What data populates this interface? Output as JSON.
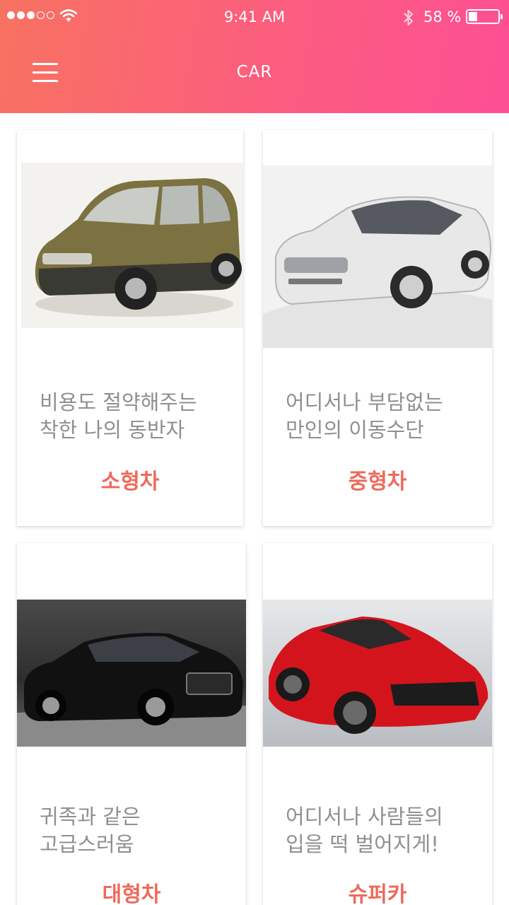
{
  "status_bar": {
    "time": "9:41 AM",
    "battery_percent": "58 %",
    "battery_level": 0.3
  },
  "header": {
    "title": "CAR",
    "gradient_start": "#f87261",
    "gradient_end": "#fd4f94"
  },
  "cards": [
    {
      "desc_line1": "비용도 절약해주는",
      "desc_line2": "착한 나의 동반자",
      "category": "소형차",
      "image_alt": "olive compact hatchback"
    },
    {
      "desc_line1": "어디서나 부담없는",
      "desc_line2": "만인의 이동수단",
      "category": "중형차",
      "image_alt": "silver midsize sedan"
    },
    {
      "desc_line1": "귀족과 같은",
      "desc_line2": "고급스러움",
      "category": "대형차",
      "image_alt": "black luxury sedan"
    },
    {
      "desc_line1": "어디서나 사람들의",
      "desc_line2": "입을 떡 벌어지게!",
      "category": "슈퍼카",
      "image_alt": "red supercar"
    }
  ],
  "colors": {
    "category_text": "#ee6a5b",
    "desc_text": "#8f8f8f"
  }
}
